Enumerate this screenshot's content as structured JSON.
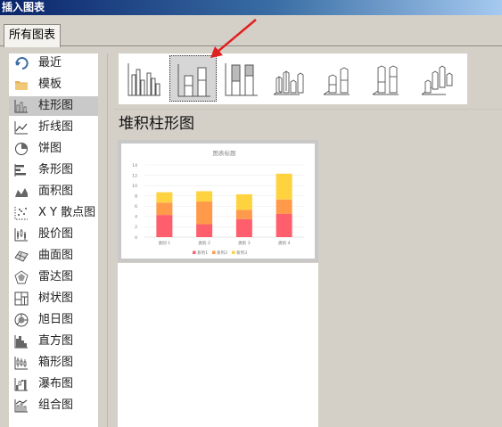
{
  "window": {
    "title": "插入图表"
  },
  "tabs": [
    {
      "label": "所有图表"
    }
  ],
  "sidebar": {
    "items": [
      {
        "label": "最近",
        "icon": "recent-icon"
      },
      {
        "label": "模板",
        "icon": "folder-icon"
      },
      {
        "label": "柱形图",
        "icon": "column-chart-icon",
        "selected": true
      },
      {
        "label": "折线图",
        "icon": "line-chart-icon"
      },
      {
        "label": "饼图",
        "icon": "pie-chart-icon"
      },
      {
        "label": "条形图",
        "icon": "bar-chart-icon"
      },
      {
        "label": "面积图",
        "icon": "area-chart-icon"
      },
      {
        "label": "X Y 散点图",
        "icon": "scatter-chart-icon"
      },
      {
        "label": "股价图",
        "icon": "stock-chart-icon"
      },
      {
        "label": "曲面图",
        "icon": "surface-chart-icon"
      },
      {
        "label": "雷达图",
        "icon": "radar-chart-icon"
      },
      {
        "label": "树状图",
        "icon": "treemap-chart-icon"
      },
      {
        "label": "旭日图",
        "icon": "sunburst-chart-icon"
      },
      {
        "label": "直方图",
        "icon": "histogram-chart-icon"
      },
      {
        "label": "箱形图",
        "icon": "box-whisker-chart-icon"
      },
      {
        "label": "瀑布图",
        "icon": "waterfall-chart-icon"
      },
      {
        "label": "组合图",
        "icon": "combo-chart-icon"
      }
    ]
  },
  "subtypes": [
    {
      "icon": "clustered-column-icon"
    },
    {
      "icon": "stacked-column-icon",
      "selected": true
    },
    {
      "icon": "percent-stacked-column-icon"
    },
    {
      "icon": "3d-clustered-column-icon"
    },
    {
      "icon": "3d-stacked-column-icon"
    },
    {
      "icon": "3d-percent-stacked-column-icon"
    },
    {
      "icon": "3d-column-icon"
    }
  ],
  "section": {
    "title": "堆积柱形图"
  },
  "colors": {
    "series1": "#ff5f6d",
    "series2": "#ff9a4a",
    "series3": "#ffd23f",
    "accent_arrow": "#e02020"
  },
  "chart_data": {
    "type": "bar",
    "stacked": true,
    "title": "图表标题",
    "categories": [
      "类别 1",
      "类别 2",
      "类别 3",
      "类别 4"
    ],
    "series": [
      {
        "name": "系列1",
        "values": [
          4.3,
          2.5,
          3.5,
          4.5
        ]
      },
      {
        "name": "系列2",
        "values": [
          2.4,
          4.4,
          1.8,
          2.8
        ]
      },
      {
        "name": "系列3",
        "values": [
          2,
          2,
          3,
          5
        ]
      }
    ],
    "yticks": [
      "0",
      "2",
      "4",
      "6",
      "8",
      "10",
      "12",
      "14"
    ],
    "ylim": [
      0,
      14
    ],
    "grid": true,
    "legend": "bottom"
  }
}
